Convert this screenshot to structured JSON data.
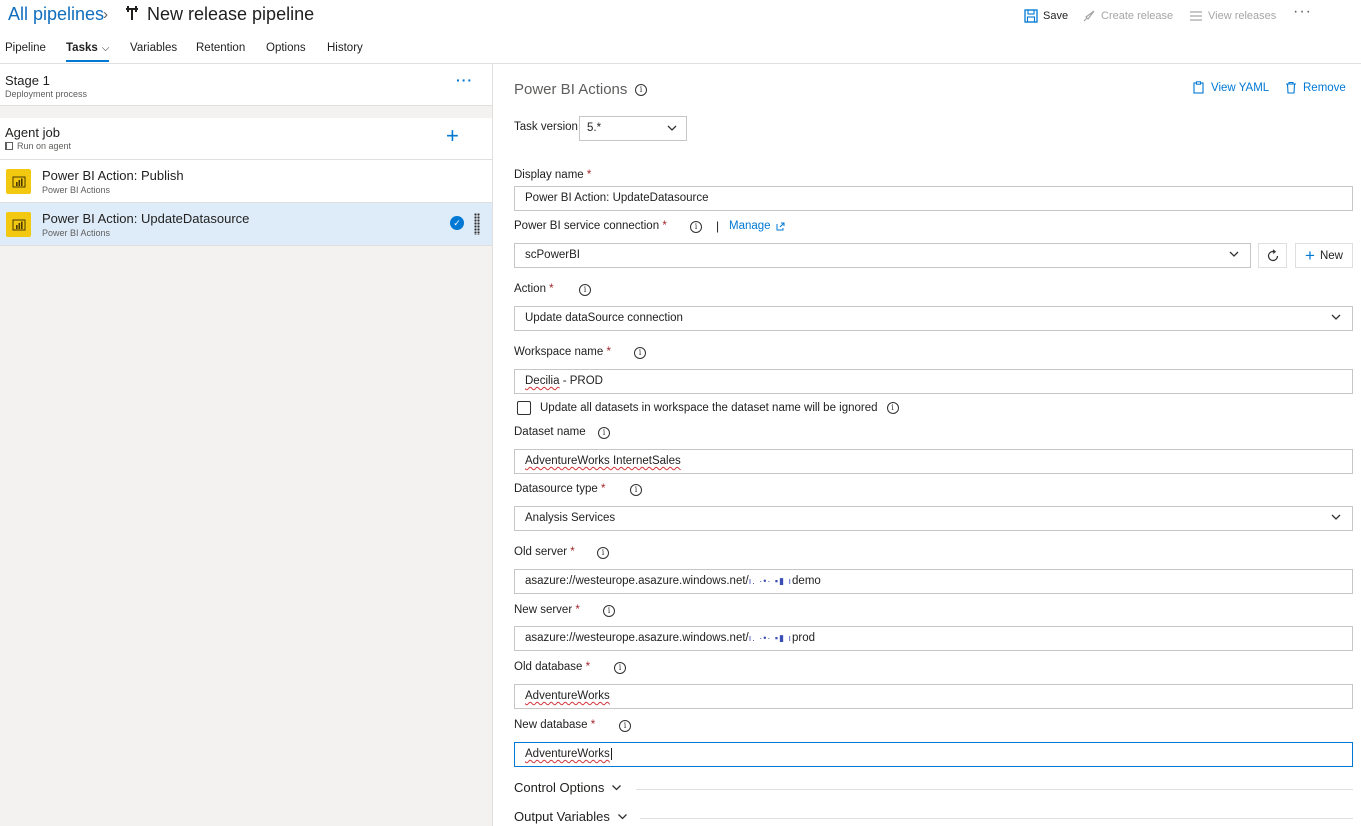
{
  "header": {
    "breadcrumb": "All pipelines",
    "title": "New release pipeline",
    "toolbar": {
      "save": "Save",
      "create_release": "Create release",
      "view_releases": "View releases",
      "more": "···"
    }
  },
  "tabs": [
    {
      "label": "Pipeline"
    },
    {
      "label": "Tasks"
    },
    {
      "label": "Variables"
    },
    {
      "label": "Retention"
    },
    {
      "label": "Options"
    },
    {
      "label": "History"
    }
  ],
  "active_tab": "Tasks",
  "left": {
    "stage": {
      "title": "Stage 1",
      "subtitle": "Deployment process",
      "more": "···"
    },
    "agent_job": {
      "title": "Agent job",
      "subtitle": "Run on agent",
      "add": "+"
    },
    "tasks": [
      {
        "title": "Power BI Action: Publish",
        "subtitle": "Power BI Actions",
        "selected": false
      },
      {
        "title": "Power BI Action: UpdateDatasource",
        "subtitle": "Power BI Actions",
        "selected": true
      }
    ]
  },
  "panel": {
    "title": "Power BI Actions",
    "view_yaml": "View YAML",
    "remove": "Remove",
    "task_version_label": "Task version",
    "task_version": "5.*",
    "display_name_label": "Display name",
    "display_name": "Power BI Action: UpdateDatasource",
    "connection_label": "Power BI service connection",
    "manage": "Manage",
    "connection": "scPowerBI",
    "new": "New",
    "action_label": "Action",
    "action": "Update dataSource connection",
    "workspace_label": "Workspace name",
    "workspace": "Decilia - PROD",
    "workspace_word": "Decilia",
    "workspace_rest": " - PROD",
    "update_all_label": "Update all datasets in workspace the dataset name will be ignored",
    "dataset_label": "Dataset name",
    "dataset": "AdventureWorks InternetSales",
    "datasource_type_label": "Datasource type",
    "datasource_type": "Analysis Services",
    "old_server_label": "Old server",
    "old_server_prefix": "asazure://westeurope.asazure.windows.net/",
    "old_server_suffix": "demo",
    "new_server_label": "New server",
    "new_server_prefix": "asazure://westeurope.asazure.windows.net/",
    "new_server_suffix": "prod",
    "old_database_label": "Old database",
    "old_database": "AdventureWorks",
    "new_database_label": "New database",
    "new_database": "AdventureWorks",
    "control_options": "Control Options",
    "output_variables": "Output Variables"
  },
  "colors": {
    "accent": "#0078d4",
    "required": "#a4262c",
    "powerbi": "#f2c811",
    "selected_row": "#deecf9"
  }
}
